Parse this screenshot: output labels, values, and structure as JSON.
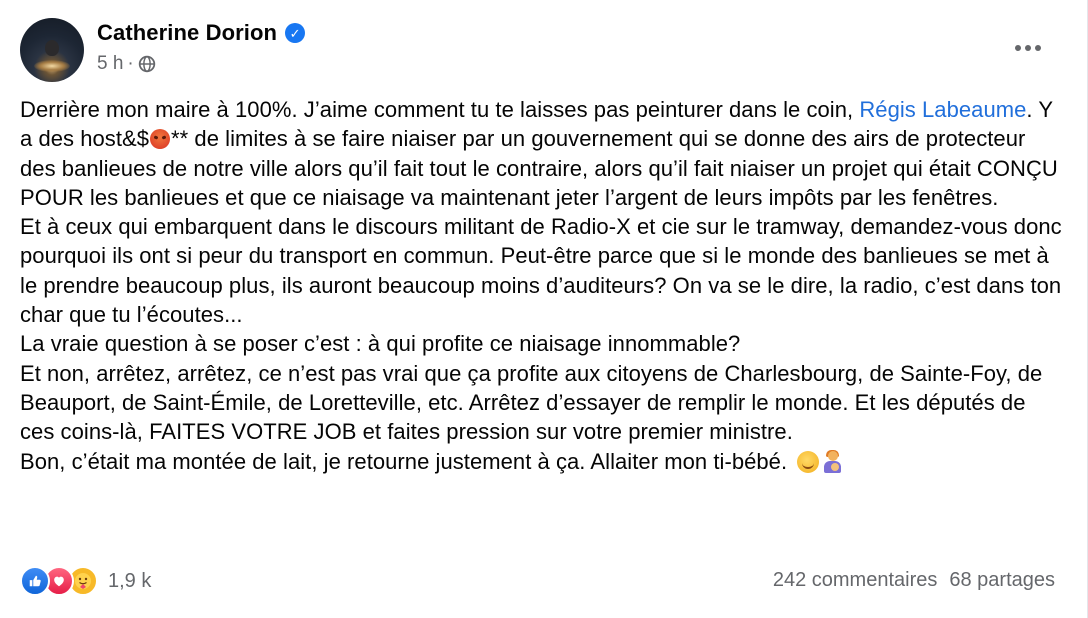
{
  "post": {
    "author": "Catherine Dorion",
    "verified_icon": "verified-badge-icon",
    "time": "5 h",
    "dot": "·",
    "privacy_icon": "globe-icon",
    "more_icon": "more-options-icon",
    "text": {
      "p1_before": "Derrière mon maire à 100%. J’aime comment tu te laisses pas peinturer dans le coin, ",
      "mention": "Régis Labeaume",
      "p1_a": ". Y a des host&$",
      "p1_b": "** de limites à se faire niaiser par un gouvernement qui se donne des airs de protecteur des banlieues de notre ville alors qu’il fait tout le contraire, alors qu’il fait niaiser un projet qui était CONÇU POUR les banlieues et que ce niaisage va maintenant jeter l’argent de leurs impôts par les fenêtres.",
      "p2": "Et à ceux qui embarquent dans le discours militant de Radio-X et cie sur le tramway, demandez-vous donc pourquoi ils ont si peur du transport en commun. Peut-être parce que si le monde des banlieues se met à le prendre beaucoup plus, ils auront beaucoup moins d’auditeurs? On va se le dire, la radio, c’est dans ton char que tu l’écoutes...",
      "p3": "La vraie question à se poser c’est : à qui profite ce niaisage innommable?",
      "p4": "Et non, arrêtez, arrêtez, ce n’est pas vrai que ça profite aux citoyens de Charlesbourg, de Sainte-Foy, de Beauport, de Saint-Émile, de Loretteville, etc. Arrêtez d’essayer de remplir le monde. Et les députés de ces coins-là, FAITES VOTRE JOB et faites pression sur votre premier ministre.",
      "p5": "Bon, c’était ma montée de lait, je retourne justement à ça. Allaiter mon ti-bébé. "
    },
    "emojis": [
      "angry-face-emoji",
      "smiling-face-emoji",
      "breastfeeding-emoji"
    ]
  },
  "footer": {
    "reaction_icons": [
      "like-reaction-icon",
      "love-reaction-icon",
      "care-reaction-icon"
    ],
    "reaction_count": "1,9 k",
    "comments": "242 commentaires",
    "shares": "68 partages"
  },
  "colors": {
    "link": "#216fdb",
    "secondary_text": "#65676b",
    "verified": "#1877f2"
  }
}
